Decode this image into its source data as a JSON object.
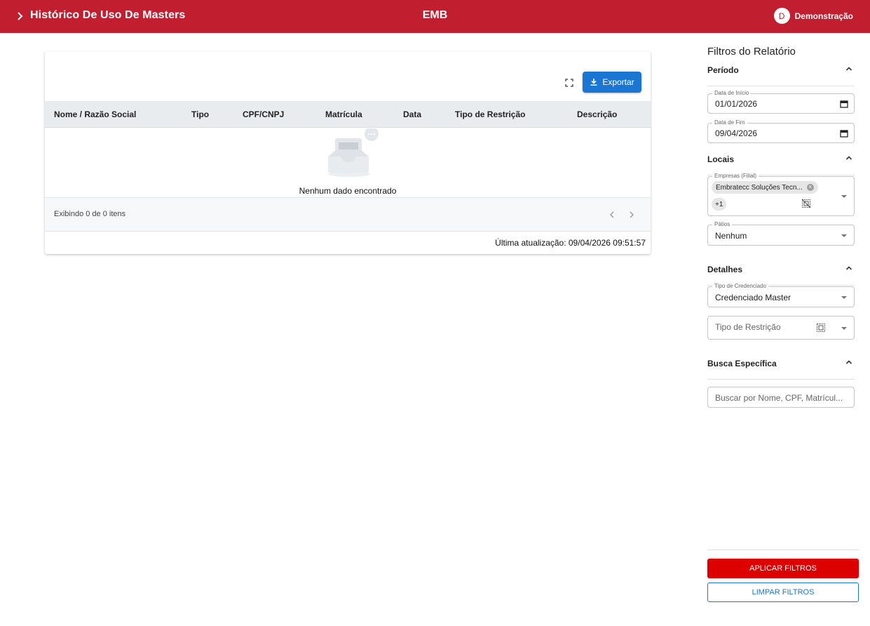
{
  "header": {
    "title": "Histórico De Uso De Masters",
    "center": "EMB",
    "user_initial": "D",
    "user_name": "Demonstração",
    "color": "#c11f2f"
  },
  "toolbar": {
    "fullscreen_icon": "fullscreen-icon",
    "export_label": "Exportar",
    "export_icon": "download-icon",
    "export_color": "#1976d2"
  },
  "table": {
    "columns": [
      "Nome / Razão Social",
      "Tipo",
      "CPF/CNPJ",
      "Matrícula",
      "Data",
      "Tipo de Restrição",
      "Descrição"
    ],
    "empty_message": "Nenhum dado encontrado",
    "footer_count": "Exibindo 0 de 0 itens",
    "last_update": "Última atualização: 09/04/2026 09:51:57"
  },
  "sidebar": {
    "title": "Filtros do Relatório",
    "periodo": {
      "label": "Período",
      "start_label": "Data de Início",
      "start_value": "01/01/2026",
      "end_label": "Data de Fim",
      "end_value": "09/04/2026"
    },
    "locais": {
      "label": "Locais",
      "empresas_label": "Empresas (Filial)",
      "empresas_chip": "Embratecc Soluções Tecn...",
      "empresas_more": "+1",
      "patios_label": "Pátios",
      "patios_value": "Nenhum"
    },
    "detalhes": {
      "label": "Detalhes",
      "tipo_credenciado_label": "Tipo de Credenciado",
      "tipo_credenciado_value": "Credenciado Master",
      "tipo_restricao_placeholder": "Tipo de Restrição"
    },
    "busca": {
      "label": "Busca Específica",
      "placeholder": "Buscar por Nome, CPF, Matrícul..."
    },
    "apply_label": "APLICAR FILTROS",
    "apply_color": "#dd0000",
    "clear_label": "LIMPAR FILTROS"
  }
}
